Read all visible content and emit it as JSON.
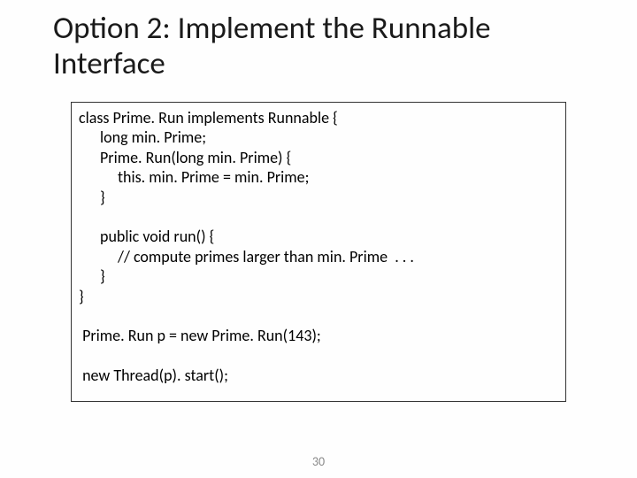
{
  "title": "Option 2: Implement the Runnable Interface",
  "code": {
    "l1": "class Prime. Run implements Runnable {",
    "l2": "long min. Prime;",
    "l3": "Prime. Run(long min. Prime) {",
    "l4": "this. min. Prime = min. Prime;",
    "l5": "}",
    "l6": "public void run() {",
    "l7": "// compute primes larger than min. Prime  . . .",
    "l8": "}",
    "l9": "}",
    "l10": " Prime. Run p = new Prime. Run(143);",
    "l11": " new Thread(p). start();"
  },
  "page_number": "30"
}
